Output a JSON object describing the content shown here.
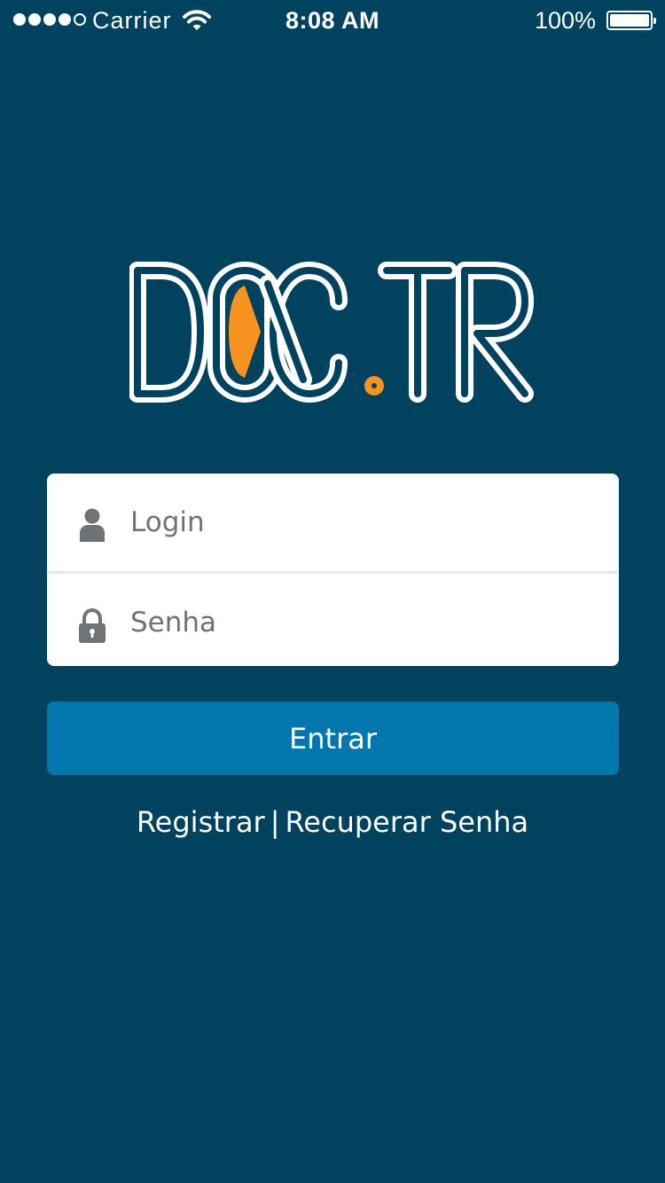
{
  "status_bar": {
    "carrier": "Carrier",
    "time": "8:08 AM",
    "battery": "100%",
    "signal_bars_filled": 4,
    "signal_bars_total": 5
  },
  "logo": {
    "text": "DOC.TR",
    "accent_color": "#f7931e"
  },
  "form": {
    "login_placeholder": "Login",
    "login_icon": "user-icon",
    "password_placeholder": "Senha",
    "password_icon": "lock-icon"
  },
  "actions": {
    "enter_label": "Entrar",
    "register_label": "Registrar",
    "separator": "|",
    "recover_label": "Recuperar Senha"
  },
  "colors": {
    "background": "#01425e",
    "button": "#0177ae",
    "card": "#ffffff",
    "icon_gray": "#6f7276"
  }
}
